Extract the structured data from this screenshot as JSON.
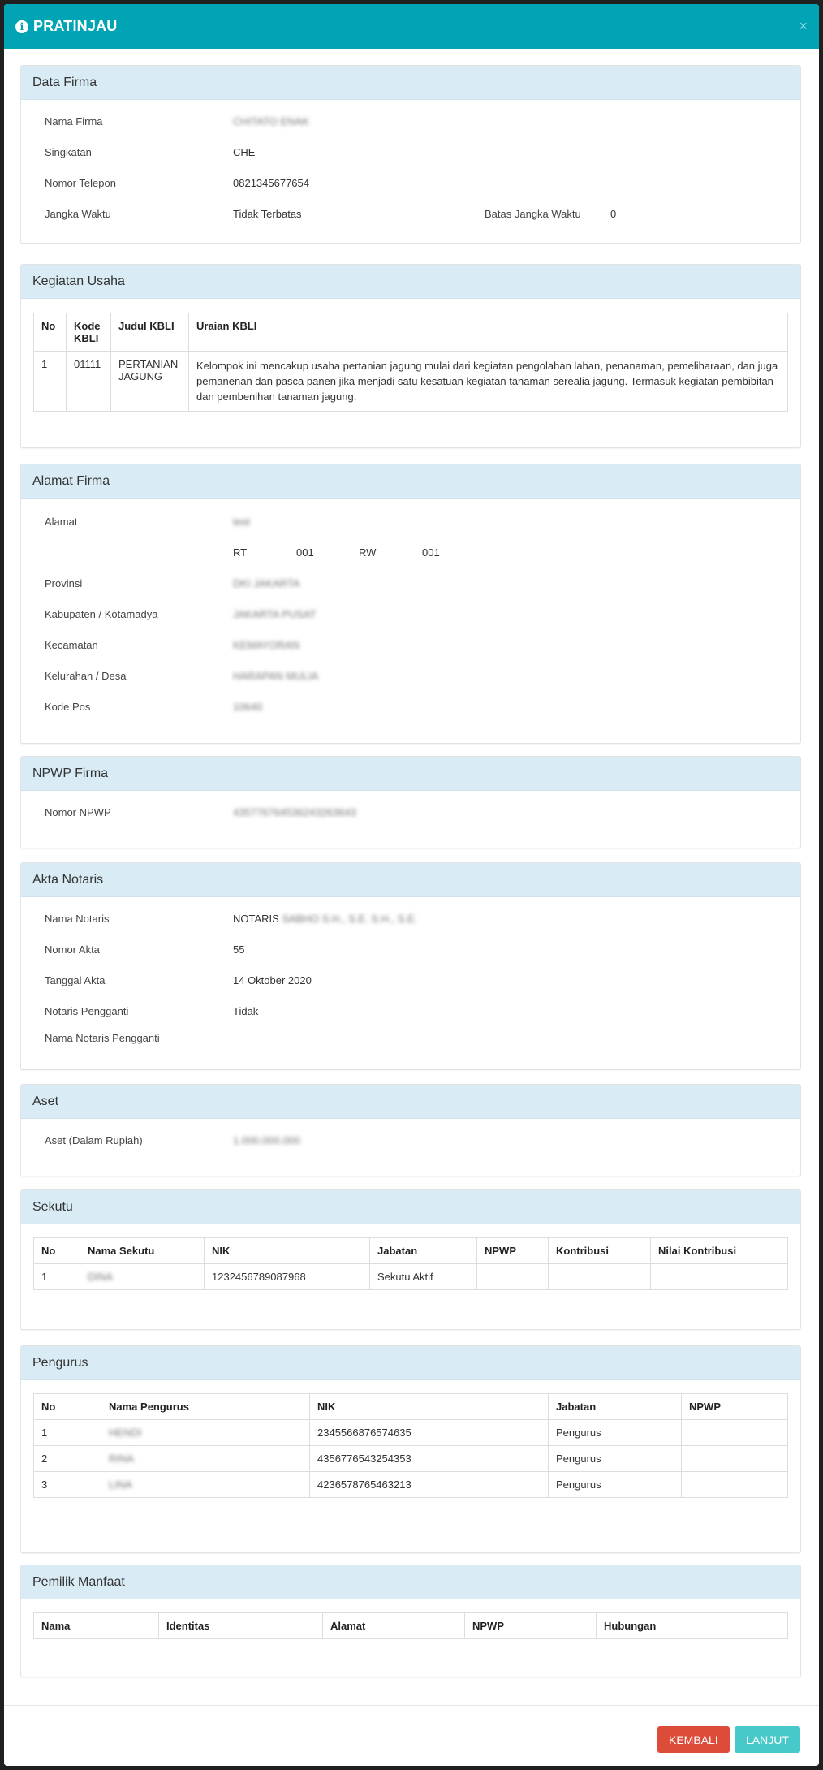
{
  "modal": {
    "title": "PRATINJAU",
    "close": "×"
  },
  "data_firma": {
    "heading": "Data Firma",
    "nama_label": "Nama Firma",
    "nama_value": "CHITATO ENAK",
    "singkatan_label": "Singkatan",
    "singkatan_value": "CHE",
    "telepon_label": "Nomor Telepon",
    "telepon_value": "0821345677654",
    "jangka_label": "Jangka Waktu",
    "jangka_value": "Tidak Terbatas",
    "batas_label": "Batas Jangka Waktu",
    "batas_value": "0"
  },
  "kegiatan": {
    "heading": "Kegiatan Usaha",
    "headers": [
      "No",
      "Kode KBLI",
      "Judul KBLI",
      "Uraian KBLI"
    ],
    "rows": [
      [
        "1",
        "01111",
        "PERTANIAN JAGUNG",
        "Kelompok ini mencakup usaha pertanian jagung mulai dari kegiatan pengolahan lahan, penanaman, pemeliharaan, dan juga pemanenan dan pasca panen jika menjadi satu kesatuan kegiatan tanaman serealia jagung. Termasuk kegiatan pembibitan dan pembenihan tanaman jagung."
      ]
    ]
  },
  "alamat": {
    "heading": "Alamat Firma",
    "alamat_label": "Alamat",
    "alamat_value": "test",
    "rt_label": "RT",
    "rt_value": "001",
    "rw_label": "RW",
    "rw_value": "001",
    "provinsi_label": "Provinsi",
    "provinsi_value": "DKI JAKARTA",
    "kabupaten_label": "Kabupaten / Kotamadya",
    "kabupaten_value": "JAKARTA PUSAT",
    "kecamatan_label": "Kecamatan",
    "kecamatan_value": "KEMAYORAN",
    "kelurahan_label": "Kelurahan / Desa",
    "kelurahan_value": "HARAPAN MULIA",
    "kodepos_label": "Kode Pos",
    "kodepos_value": "10640"
  },
  "npwp": {
    "heading": "NPWP Firma",
    "label": "Nomor NPWP",
    "value": "435776764536243263643"
  },
  "akta": {
    "heading": "Akta Notaris",
    "nama_label": "Nama Notaris",
    "nama_value": "NOTARIS",
    "nama_blur": "SABHO S.H., S.E. S.H., S.E.",
    "nomor_label": "Nomor Akta",
    "nomor_value": "55",
    "tanggal_label": "Tanggal Akta",
    "tanggal_value": "14 Oktober 2020",
    "pengganti_label": "Notaris Pengganti",
    "pengganti_value": "Tidak",
    "nama_pengganti_label": "Nama Notaris Pengganti"
  },
  "aset": {
    "heading": "Aset",
    "label": "Aset (Dalam Rupiah)",
    "value": "1.000.000.000"
  },
  "sekutu": {
    "heading": "Sekutu",
    "headers": [
      "No",
      "Nama Sekutu",
      "NIK",
      "Jabatan",
      "NPWP",
      "Kontribusi",
      "Nilai Kontribusi"
    ],
    "rows": [
      [
        "1",
        "DINA",
        "1232456789087968",
        "Sekutu Aktif",
        "",
        "",
        ""
      ]
    ]
  },
  "pengurus": {
    "heading": "Pengurus",
    "headers": [
      "No",
      "Nama Pengurus",
      "NIK",
      "Jabatan",
      "NPWP"
    ],
    "rows": [
      [
        "1",
        "HENDI",
        "2345566876574635",
        "Pengurus",
        ""
      ],
      [
        "2",
        "RINA",
        "4356776543254353",
        "Pengurus",
        ""
      ],
      [
        "3",
        "LINA",
        "4236578765463213",
        "Pengurus",
        ""
      ]
    ]
  },
  "pemilik": {
    "heading": "Pemilik Manfaat",
    "headers": [
      "Nama",
      "Identitas",
      "Alamat",
      "NPWP",
      "Hubungan"
    ]
  },
  "footer": {
    "kembali": "KEMBALI",
    "lanjut": "LANJUT"
  }
}
